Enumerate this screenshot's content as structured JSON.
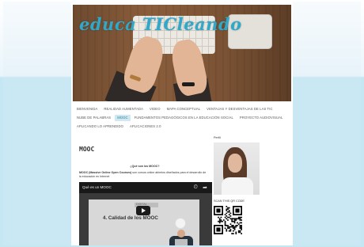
{
  "header": {
    "logo_text": "educa TICleando"
  },
  "nav": {
    "rows": [
      [
        "BIENVENIDA",
        "REALIDAD AUMENTADA",
        "VIDEO",
        "MAPA CONCEPTUAL",
        "VENTAJAS Y DESVENTAJAS DE LAS TIC"
      ],
      [
        "NUBE DE PALABRAS",
        "MOOC",
        "FUNDAMENTOS PEDAGÓGICOS EN LA EDUCACIÓN SOCIAL",
        "PROYECTO AUDIOVISUAL"
      ],
      [
        "APLICANDO LO APRENDIDO",
        "APLICACIONES 2.0"
      ]
    ],
    "active": "MOOC"
  },
  "post": {
    "title": "MOOC",
    "question": "¿Qué son los MOOC?",
    "paragraph_bold": "MOOC (Massive Online Open Courses)",
    "paragraph_rest": " son cursos online abiertos diseñados para el desarrollo de la educación en Internet"
  },
  "video": {
    "title": "Qué es un MOOC",
    "clock_icon": "clock-icon",
    "share_icon": "share-icon",
    "mini_header": "DIGITAL",
    "slide_text": "4. Calidad de los MOOC"
  },
  "sidebar": {
    "profile_title": "Perfil",
    "qr_title": "SCAN THIS QR CODE"
  },
  "colors": {
    "accent": "#2fa8c9",
    "active_nav_bg": "#cfe8f2",
    "background_blue": "#c5e6f3"
  }
}
